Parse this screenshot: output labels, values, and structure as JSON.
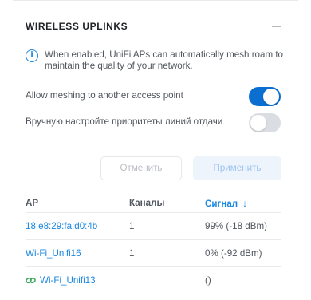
{
  "section": {
    "title": "WIRELESS UPLINKS",
    "info_text": "When enabled, UniFi APs can automatically mesh roam to maintain the quality of your network."
  },
  "toggles": [
    {
      "label": "Allow meshing to another access point",
      "on": true
    },
    {
      "label": "Вручную настройте приоритеты линий отдачи",
      "on": false
    }
  ],
  "buttons": {
    "cancel": "Отменить",
    "apply": "Применить"
  },
  "table": {
    "columns": {
      "ap": "AP",
      "channels": "Каналы",
      "signal": "Сигнал"
    },
    "sort_icon": "arrow-down-icon",
    "rows": [
      {
        "ap": "18:e8:29:fa:d0:4b",
        "channels": "1",
        "signal": "99% (-18 dBm)",
        "linked": false
      },
      {
        "ap": "Wi-Fi_Unifi16",
        "channels": "1",
        "signal": "0% (-92 dBm)",
        "linked": false
      },
      {
        "ap": "Wi-Fi_Unifi13",
        "channels": "",
        "signal": "()",
        "linked": true
      }
    ]
  },
  "colors": {
    "accent": "#1b87e0",
    "toggle_on": "#0a6fd0",
    "toggle_off": "#dadde2"
  }
}
